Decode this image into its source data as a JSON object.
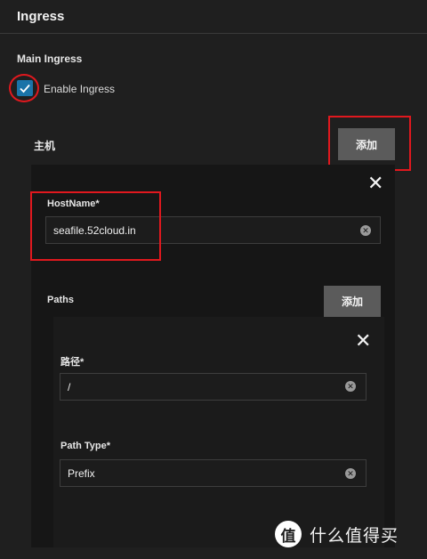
{
  "page": {
    "title": "Ingress"
  },
  "main_ingress": {
    "section_label": "Main Ingress",
    "enable_checkbox": {
      "label": "Enable Ingress",
      "checked": true
    }
  },
  "hosts": {
    "title": "主机",
    "add_label": "添加",
    "items": [
      {
        "hostname_label": "HostName",
        "hostname_value": "seafile.52cloud.in",
        "required_mark": "*",
        "close_glyph": "✕",
        "paths": {
          "title": "Paths",
          "add_label": "添加",
          "items": [
            {
              "close_glyph": "✕",
              "path_label": "路径",
              "path_value": "/",
              "path_type_label": "Path Type",
              "path_type_value": "Prefix"
            }
          ]
        }
      }
    ]
  },
  "watermark": {
    "logo_text": "值",
    "text": "什么值得买"
  },
  "colors": {
    "accent": "#1a73a8",
    "annotation": "#e0181e",
    "button_bg": "#5b5b5b"
  }
}
